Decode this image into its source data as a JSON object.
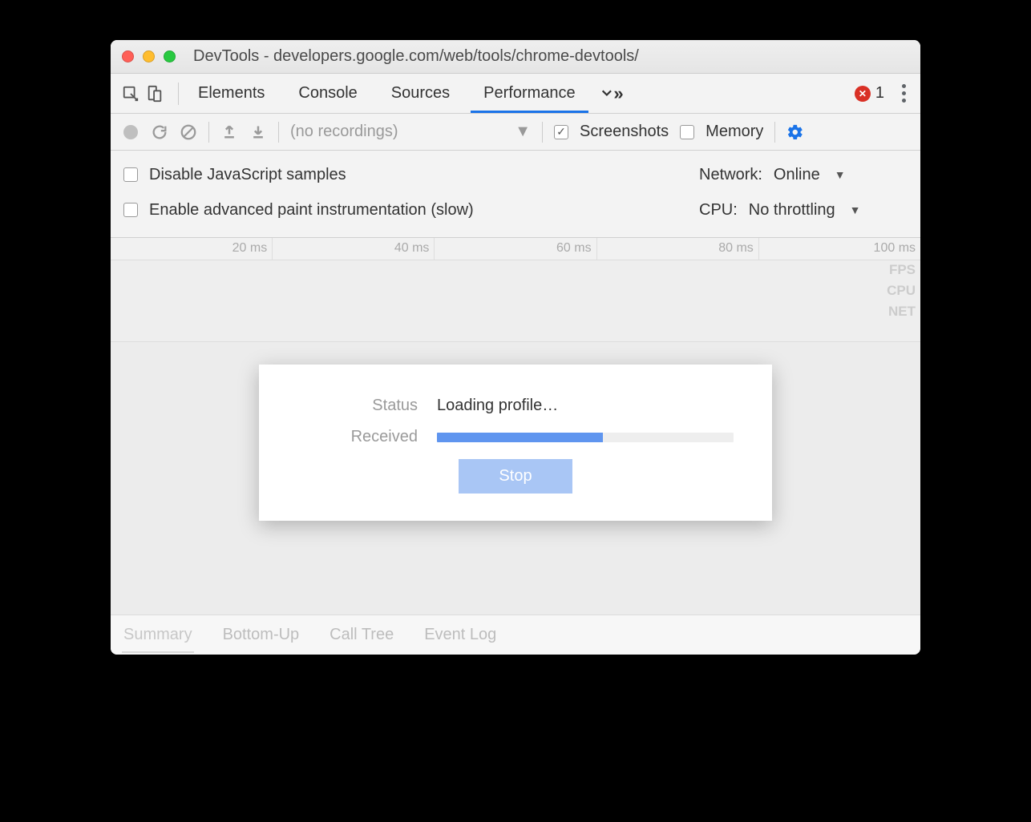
{
  "window": {
    "title": "DevTools - developers.google.com/web/tools/chrome-devtools/"
  },
  "tabs": {
    "items": [
      "Elements",
      "Console",
      "Sources",
      "Performance"
    ],
    "active": "Performance",
    "error_count": "1"
  },
  "toolbar": {
    "recordings_label": "(no recordings)",
    "screenshots_label": "Screenshots",
    "memory_label": "Memory",
    "screenshots_checked": true,
    "memory_checked": false
  },
  "settings": {
    "disable_js_label": "Disable JavaScript samples",
    "enable_paint_label": "Enable advanced paint instrumentation (slow)",
    "network_label": "Network:",
    "network_value": "Online",
    "cpu_label": "CPU:",
    "cpu_value": "No throttling"
  },
  "timeline": {
    "ticks": [
      "20 ms",
      "40 ms",
      "60 ms",
      "80 ms",
      "100 ms"
    ],
    "lanes": [
      "FPS",
      "CPU",
      "NET"
    ]
  },
  "dialog": {
    "status_label": "Status",
    "status_value": "Loading profile…",
    "received_label": "Received",
    "progress_pct": 56,
    "stop_label": "Stop"
  },
  "bottom_tabs": {
    "items": [
      "Summary",
      "Bottom-Up",
      "Call Tree",
      "Event Log"
    ],
    "active": "Summary"
  }
}
